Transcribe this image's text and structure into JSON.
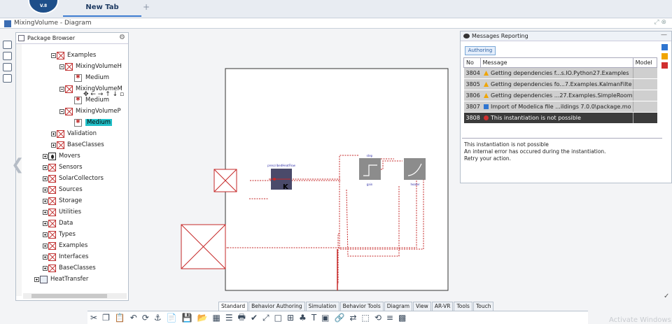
{
  "browser": {
    "logo_text": "V.8",
    "tab_label": "New Tab",
    "new_tab_symbol": "+"
  },
  "window": {
    "title": "MixingVolume - Diagram",
    "controls": "⤢ ⊗"
  },
  "package_browser": {
    "title": "Package Browser",
    "mini_tools": "✥ ← → ↑ ↓ ▫",
    "tree": [
      {
        "label": "Examples",
        "indent": 2,
        "type": "pkg",
        "plus": "open"
      },
      {
        "label": "MixingVolumeH",
        "indent": 3,
        "type": "pkg",
        "plus": "open"
      },
      {
        "label": "Medium",
        "indent": 4,
        "type": "medium"
      },
      {
        "label": "MixingVolumeM",
        "indent": 3,
        "type": "pkg",
        "plus": "open"
      },
      {
        "label": "Medium",
        "indent": 4,
        "type": "medium"
      },
      {
        "label": "MixingVolumeP",
        "indent": 3,
        "type": "pkg",
        "plus": "open"
      },
      {
        "label": "Medium",
        "indent": 4,
        "type": "medium",
        "selected": true
      },
      {
        "label": "Validation",
        "indent": 2,
        "type": "pkg",
        "plus": "closed"
      },
      {
        "label": "BaseClasses",
        "indent": 2,
        "type": "pkg",
        "plus": "closed"
      },
      {
        "label": "Movers",
        "indent": 1,
        "type": "black",
        "plus": "closed"
      },
      {
        "label": "Sensors",
        "indent": 1,
        "type": "pkg",
        "plus": "closed"
      },
      {
        "label": "SolarCollectors",
        "indent": 1,
        "type": "pkg",
        "plus": "closed"
      },
      {
        "label": "Sources",
        "indent": 1,
        "type": "pkg",
        "plus": "closed"
      },
      {
        "label": "Storage",
        "indent": 1,
        "type": "pkg",
        "plus": "closed"
      },
      {
        "label": "Utilities",
        "indent": 1,
        "type": "pkg",
        "plus": "closed"
      },
      {
        "label": "Data",
        "indent": 1,
        "type": "pkg",
        "plus": "closed"
      },
      {
        "label": "Types",
        "indent": 1,
        "type": "pkg",
        "plus": "closed"
      },
      {
        "label": "Examples",
        "indent": 1,
        "type": "pkg",
        "plus": "closed"
      },
      {
        "label": "Interfaces",
        "indent": 1,
        "type": "pkg",
        "plus": "closed"
      },
      {
        "label": "BaseClasses",
        "indent": 1,
        "type": "pkg",
        "plus": "closed"
      },
      {
        "label": "HeatTransfer",
        "indent": 0,
        "type": "grey",
        "plus": "closed"
      }
    ]
  },
  "diagram": {
    "component_labels": {
      "source": "prescribedHeatFlow",
      "source_letter": "K",
      "block1": "step",
      "block1_bottom": "gain",
      "block2": "heater"
    }
  },
  "messages": {
    "title": "Messages Reporting",
    "filter_button": "Authoring",
    "columns": [
      "No",
      "Message",
      "Model"
    ],
    "rows": [
      {
        "no": "3804",
        "level": "warning",
        "message": "Getting dependencies f...s.IO.Python27.Examples",
        "model": ""
      },
      {
        "no": "3805",
        "level": "warning",
        "message": "Getting dependencies fo...7.Examples.KalmanFilte",
        "model": ""
      },
      {
        "no": "3806",
        "level": "warning",
        "message": "Getting dependencies ...27.Examples.SimpleRoom",
        "model": ""
      },
      {
        "no": "3807",
        "level": "info",
        "message": "Import of Modelica file ...ildings 7.0.0\\package.mo",
        "model": ""
      },
      {
        "no": "3808",
        "level": "error",
        "message": "This instantiation is not possible",
        "model": ""
      }
    ],
    "detail": [
      "This instantiation is not possible",
      "An internal error has occured during the instantiation.",
      "Retry your action."
    ]
  },
  "ribbon": {
    "tabs": [
      "Standard",
      "Behavior Authoring",
      "Simulation",
      "Behavior Tools",
      "Diagram",
      "View",
      "AR-VR",
      "Tools",
      "Touch"
    ],
    "active_tab": "Standard",
    "icons": [
      "scissors-icon",
      "copy-icon",
      "paste-icon",
      "undo-icon",
      "update-icon",
      "anchor-icon",
      "new-icon",
      "save-icon",
      "open-icon",
      "table-icon",
      "list-icon",
      "print-icon",
      "check-icon",
      "fit-icon",
      "frame-icon",
      "tree-icon",
      "graph-icon",
      "text-icon",
      "image-icon",
      "link-icon",
      "connect-icon",
      "select-icon",
      "rotate-icon",
      "align-icon",
      "grid-icon"
    ],
    "icon_glyphs": [
      "✂",
      "❐",
      "📋",
      "↶",
      "⟳",
      "⚓",
      "📄",
      "💾",
      "📂",
      "▦",
      "☰",
      "🖶",
      "✔",
      "⤢",
      "□",
      "⊞",
      "♣",
      "T",
      "▣",
      "🔗",
      "⇄",
      "⬚",
      "⟲",
      "≡",
      "▩"
    ],
    "watermark": "Activate Windows"
  }
}
